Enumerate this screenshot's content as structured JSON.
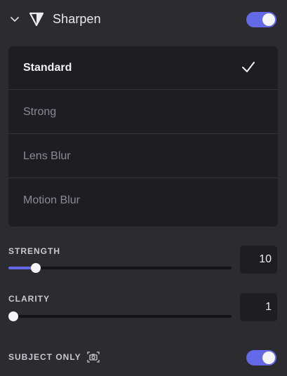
{
  "header": {
    "title": "Sharpen",
    "icon": "sharpen-triangle-icon",
    "collapse_icon": "chevron-down-icon",
    "enabled": true
  },
  "modes": {
    "items": [
      {
        "label": "Standard",
        "selected": true
      },
      {
        "label": "Strong",
        "selected": false
      },
      {
        "label": "Lens Blur",
        "selected": false
      },
      {
        "label": "Motion Blur",
        "selected": false
      }
    ]
  },
  "strength": {
    "label": "STRENGTH",
    "value": "10",
    "level": 0.1
  },
  "clarity": {
    "label": "CLARITY",
    "value": "1",
    "level": 0.0
  },
  "subject_only": {
    "label": "SUBJECT ONLY",
    "icon": "camera-icon",
    "enabled": true
  },
  "colors": {
    "accent": "#6469e8",
    "panel": "#2b2b30",
    "list_bg": "#1d1d22"
  }
}
